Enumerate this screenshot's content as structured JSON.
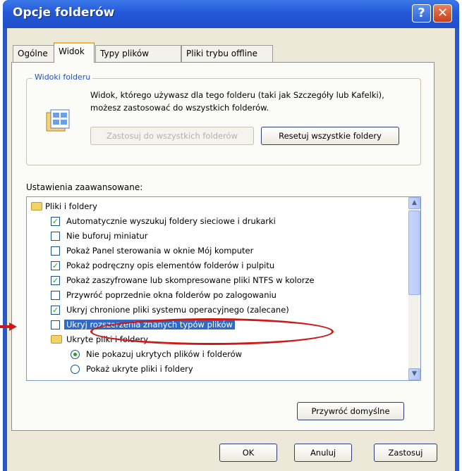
{
  "window": {
    "title": "Opcje folderów",
    "help_glyph": "?",
    "close_glyph": "✕"
  },
  "tabs": [
    {
      "label": "Ogólne"
    },
    {
      "label": "Widok"
    },
    {
      "label": "Typy plików"
    },
    {
      "label": "Pliki trybu offline"
    }
  ],
  "folder_views": {
    "title": "Widoki folderu",
    "description": "Widok, którego używasz dla tego folderu (taki jak Szczegóły lub Kafelki), możesz zastosować do wszystkich folderów.",
    "apply_all_label": "Zastosuj do wszystkich folderów",
    "reset_all_label": "Resetuj wszystkie foldery"
  },
  "advanced": {
    "label": "Ustawienia zaawansowane:",
    "items": [
      {
        "type": "folder",
        "label": "Pliki i foldery"
      },
      {
        "type": "checkbox",
        "checked": true,
        "label": "Automatycznie wyszukuj foldery sieciowe i drukarki"
      },
      {
        "type": "checkbox",
        "checked": false,
        "label": "Nie buforuj miniatur"
      },
      {
        "type": "checkbox",
        "checked": false,
        "label": "Pokaż Panel sterowania w oknie Mój komputer"
      },
      {
        "type": "checkbox",
        "checked": true,
        "label": "Pokaż podręczny opis elementów folderów i pulpitu"
      },
      {
        "type": "checkbox",
        "checked": true,
        "label": "Pokaż zaszyfrowane lub skompresowane pliki NTFS w kolorze"
      },
      {
        "type": "checkbox",
        "checked": false,
        "label": "Przywróć poprzednie okna folderów po zalogowaniu"
      },
      {
        "type": "checkbox",
        "checked": true,
        "label": "Ukryj chronione pliki systemu operacyjnego (zalecane)"
      },
      {
        "type": "checkbox",
        "checked": false,
        "selected": true,
        "label": "Ukryj rozszerzenia znanych typów plików"
      },
      {
        "type": "folder",
        "label": "Ukryte pliki i foldery"
      },
      {
        "type": "radio",
        "checked": true,
        "label": "Nie pokazuj ukrytych plików i folderów"
      },
      {
        "type": "radio",
        "checked": false,
        "label": "Pokaż ukryte pliki i foldery"
      }
    ],
    "restore_defaults_label": "Przywróć domyślne"
  },
  "footer": {
    "ok_label": "OK",
    "cancel_label": "Anuluj",
    "apply_label": "Zastosuj"
  },
  "scrollbar": {
    "up_glyph": "▲",
    "down_glyph": "▼"
  },
  "colors": {
    "title_bar": "#2458d8",
    "selection": "#316ac5",
    "annotation": "#cc1a1a",
    "check": "#21a121"
  }
}
